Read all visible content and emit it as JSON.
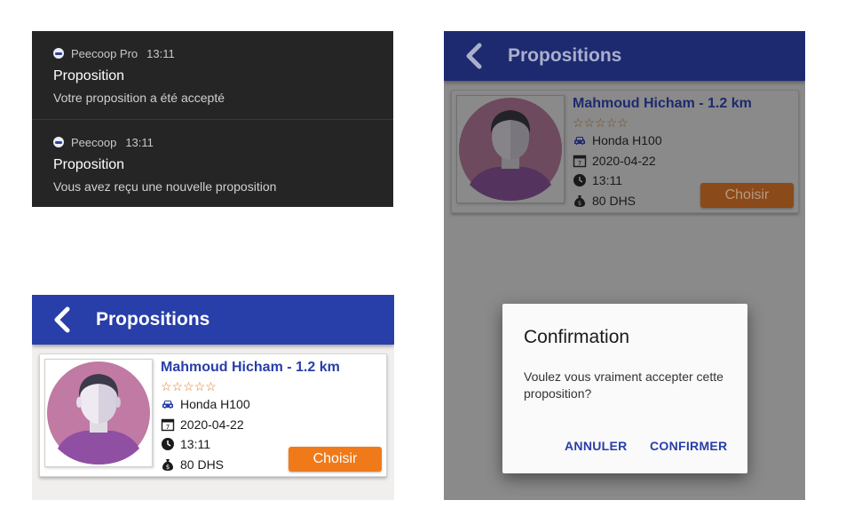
{
  "notifications": [
    {
      "app": "Peecoop Pro",
      "time": "13:11",
      "title": "Proposition",
      "body": "Votre proposition a été accepté"
    },
    {
      "app": "Peecoop",
      "time": "13:11",
      "title": "Proposition",
      "body": "Vous avez reçu une nouvelle proposition"
    }
  ],
  "screen": {
    "title": "Propositions",
    "back_icon": "chevron-left-icon"
  },
  "proposal": {
    "driver": "Mahmoud Hicham - 1.2 km",
    "rating_stars": 0,
    "rating_max": 5,
    "stars_text": "☆☆☆☆☆",
    "car": "Honda H100",
    "date": "2020-04-22",
    "time": "13:11",
    "price": "80 DHS",
    "choose_label": "Choisir"
  },
  "dialog": {
    "title": "Confirmation",
    "message": "Voulez vous vraiment accepter cette proposition?",
    "cancel_label": "ANNULER",
    "confirm_label": "CONFIRMER"
  },
  "colors": {
    "app_bar": "#283ea8",
    "accent_orange": "#f07a1a",
    "notification_bg": "#252525"
  }
}
